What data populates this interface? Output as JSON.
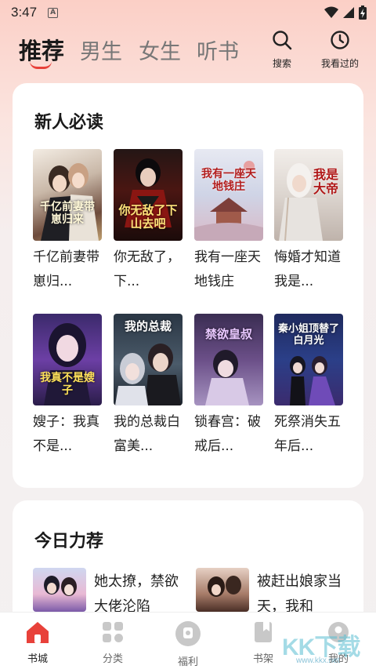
{
  "status_bar": {
    "time": "3:47",
    "notif_icon": "A"
  },
  "nav": {
    "tabs": [
      {
        "label": "推荐",
        "active": true
      },
      {
        "label": "男生",
        "active": false
      },
      {
        "label": "女生",
        "active": false
      },
      {
        "label": "听书",
        "active": false
      }
    ],
    "search_label": "搜索",
    "history_label": "我看过的"
  },
  "new_user": {
    "title": "新人必读",
    "books": [
      {
        "title": "千亿前妻带崽归...",
        "cover_text": "千亿前妻带崽归来"
      },
      {
        "title": "你无敌了，下...",
        "cover_text": "你无敌了下山去吧"
      },
      {
        "title": "我有一座天地钱庄",
        "cover_text": "我有一座天地钱庄"
      },
      {
        "title": "悔婚才知道我是...",
        "cover_text": "我是大帝"
      },
      {
        "title": "嫂子：我真不是...",
        "cover_text": "我真不是嫂子"
      },
      {
        "title": "我的总裁白富美...",
        "cover_text": "我的总裁"
      },
      {
        "title": "锁春宫：破戒后...",
        "cover_text": "禁欲皇叔"
      },
      {
        "title": "死祭消失五年后...",
        "cover_text": "秦小姐顶替了白月光"
      }
    ]
  },
  "today": {
    "title": "今日力荐",
    "books": [
      {
        "title": "她太撩，禁欲大佬沦陷"
      },
      {
        "title": "被赶出娘家当天，我和"
      }
    ]
  },
  "bottom_nav": [
    {
      "label": "书城",
      "active": true
    },
    {
      "label": "分类",
      "active": false
    },
    {
      "label": "福利",
      "active": false
    },
    {
      "label": "书架",
      "active": false
    },
    {
      "label": "我的",
      "active": false
    }
  ],
  "watermark": {
    "text": "KK下载",
    "url": "www.kkx.net"
  },
  "colors": {
    "accent": "#e8413a",
    "header_bg": "#fbcfc6"
  }
}
